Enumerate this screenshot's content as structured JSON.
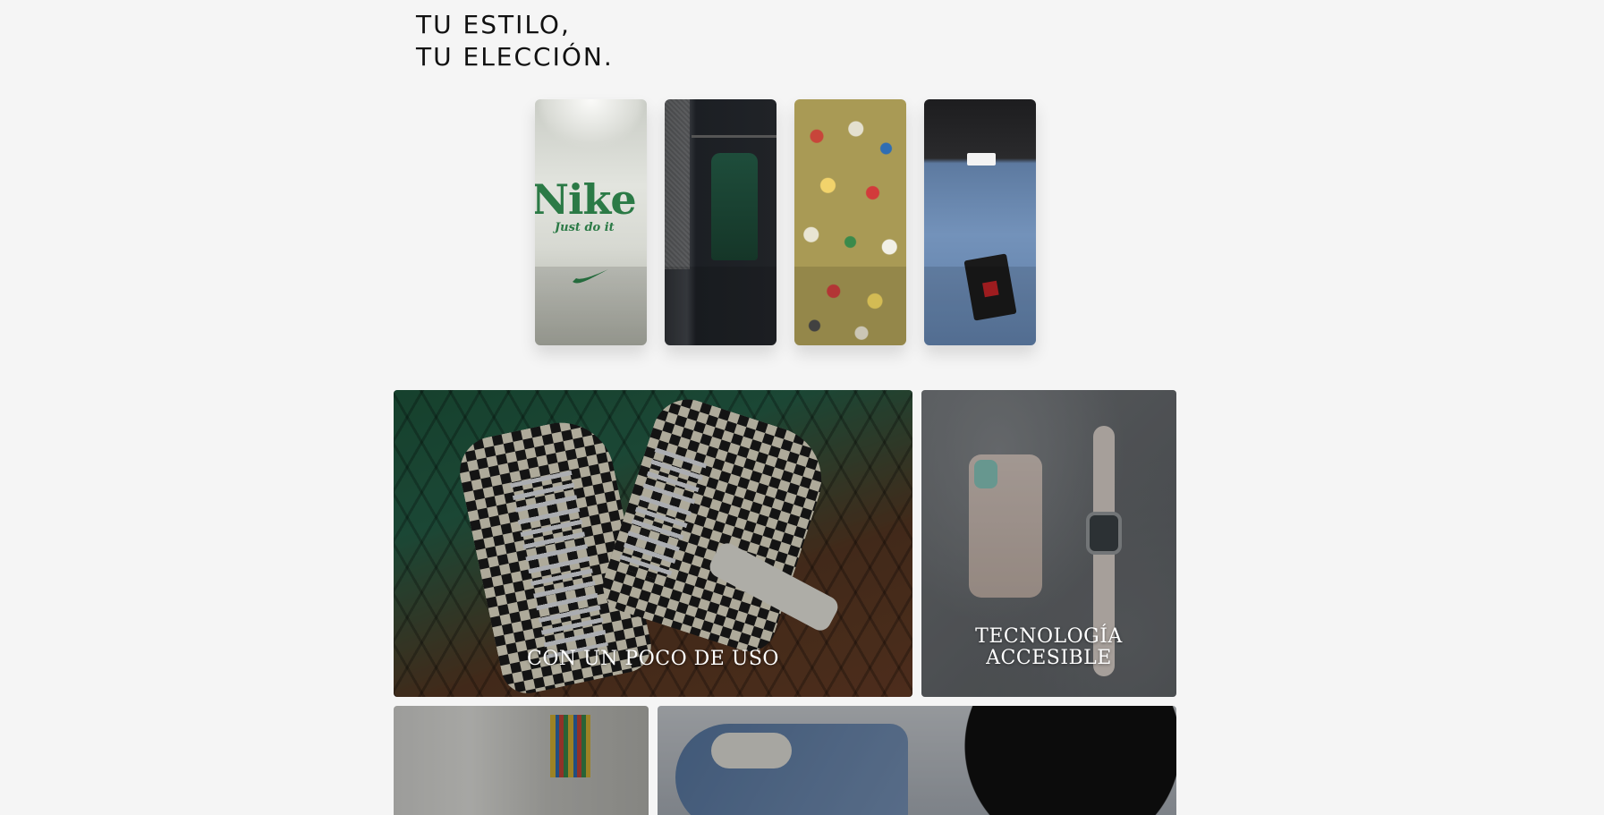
{
  "hero": {
    "line1": "TU ESTILO,",
    "line2": "TU ELECCIÓN."
  },
  "carousel": {
    "cards": [
      {
        "image": "white-nike-hoodie"
      },
      {
        "image": "green-garment-closet"
      },
      {
        "image": "pins-wall"
      },
      {
        "image": "denim-shirt-tag"
      }
    ]
  },
  "tiles": {
    "used": {
      "label": "CON UN POCO DE USO",
      "image": "checkered-sneakers"
    },
    "tech": {
      "label_line1": "TECNOLOGÍA",
      "label_line2": "ACCESIBLE",
      "image": "phone-and-watch"
    },
    "bottom_left": {
      "image": "office-pencils"
    },
    "bottom_right": {
      "image": "blue-sneaker"
    }
  },
  "card_print": {
    "nike": "Nike",
    "just_do_it": "Just do it"
  }
}
